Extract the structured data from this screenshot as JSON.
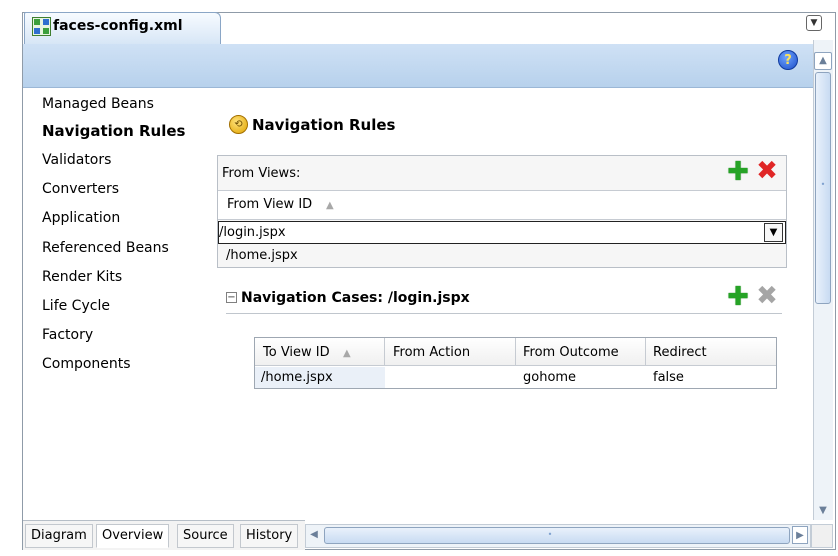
{
  "editor": {
    "tab_title": "faces-config.xml"
  },
  "sidebar": {
    "items": [
      {
        "label": "Managed Beans"
      },
      {
        "label": "Navigation Rules",
        "selected": true
      },
      {
        "label": "Validators"
      },
      {
        "label": "Converters"
      },
      {
        "label": "Application"
      },
      {
        "label": "Referenced Beans"
      },
      {
        "label": "Render Kits"
      },
      {
        "label": "Life Cycle"
      },
      {
        "label": "Factory"
      },
      {
        "label": "Components"
      }
    ]
  },
  "main": {
    "title": "Navigation Rules",
    "from_views": {
      "label": "From Views:",
      "column_header": "From View ID",
      "selected_value": "/login.jspx",
      "rows": [
        "/home.jspx"
      ]
    },
    "navigation_cases": {
      "title": "Navigation Cases: /login.jspx",
      "columns": [
        "To View ID",
        "From Action",
        "From Outcome",
        "Redirect"
      ],
      "rows": [
        {
          "to_view_id": "/home.jspx",
          "from_action": "",
          "from_outcome": "gohome",
          "redirect": "false"
        }
      ]
    }
  },
  "bottom_tabs": [
    "Diagram",
    "Overview",
    "Source",
    "History"
  ],
  "active_bottom_tab": "Overview",
  "colors": {
    "header_bar": "#c3d9f1",
    "add_green": "#26a326",
    "delete_red": "#e02626",
    "delete_disabled": "#a5a5a5"
  },
  "icons": {
    "tab_icon": "faces-config-icon",
    "help": "help-icon",
    "section": "navigation-rule-icon",
    "add": "add-icon",
    "delete": "delete-icon"
  }
}
